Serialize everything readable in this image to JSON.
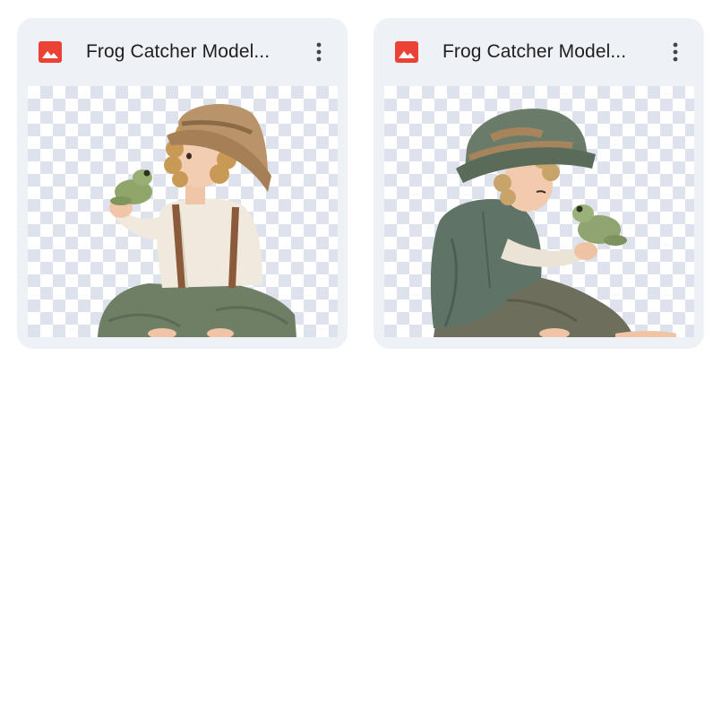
{
  "files": [
    {
      "title": "Frog Catcher Model...",
      "icon": "image-file-icon",
      "menu_icon": "more-vert-icon",
      "thumbnail": "boy-with-frog-illustration"
    },
    {
      "title": "Frog Catcher Model...",
      "icon": "image-file-icon",
      "menu_icon": "more-vert-icon",
      "thumbnail": "boy-with-frog-illustration"
    }
  ],
  "colors": {
    "card_background": "#eef1f6",
    "image_icon": "#ea4335",
    "title_text": "#1f1f1f"
  }
}
